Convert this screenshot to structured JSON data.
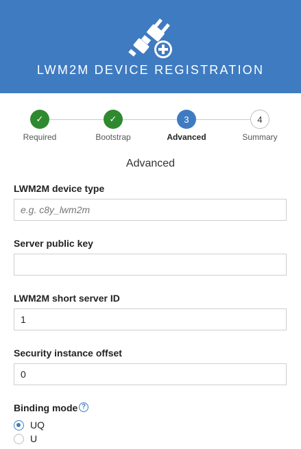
{
  "header": {
    "title": "LWM2M DEVICE REGISTRATION",
    "icon": "plug-plus-icon"
  },
  "stepper": {
    "steps": [
      {
        "label": "Required",
        "state": "done",
        "marker": "✓"
      },
      {
        "label": "Bootstrap",
        "state": "done",
        "marker": "✓"
      },
      {
        "label": "Advanced",
        "state": "active",
        "marker": "3"
      },
      {
        "label": "Summary",
        "state": "todo",
        "marker": "4"
      }
    ]
  },
  "section": {
    "title": "Advanced"
  },
  "fields": {
    "device_type": {
      "label": "LWM2M device type",
      "value": "",
      "placeholder": "e.g. c8y_lwm2m"
    },
    "server_public_key": {
      "label": "Server public key",
      "value": "",
      "placeholder": ""
    },
    "short_server_id": {
      "label": "LWM2M short server ID",
      "value": "1"
    },
    "security_instance_offset": {
      "label": "Security instance offset",
      "value": "0"
    }
  },
  "binding_mode": {
    "label": "Binding mode",
    "help_icon": "question-circle-icon",
    "options": [
      {
        "label": "UQ",
        "checked": true
      },
      {
        "label": "U",
        "checked": false
      }
    ]
  },
  "colors": {
    "brand": "#3f7bc1",
    "done": "#2f8a2f"
  }
}
